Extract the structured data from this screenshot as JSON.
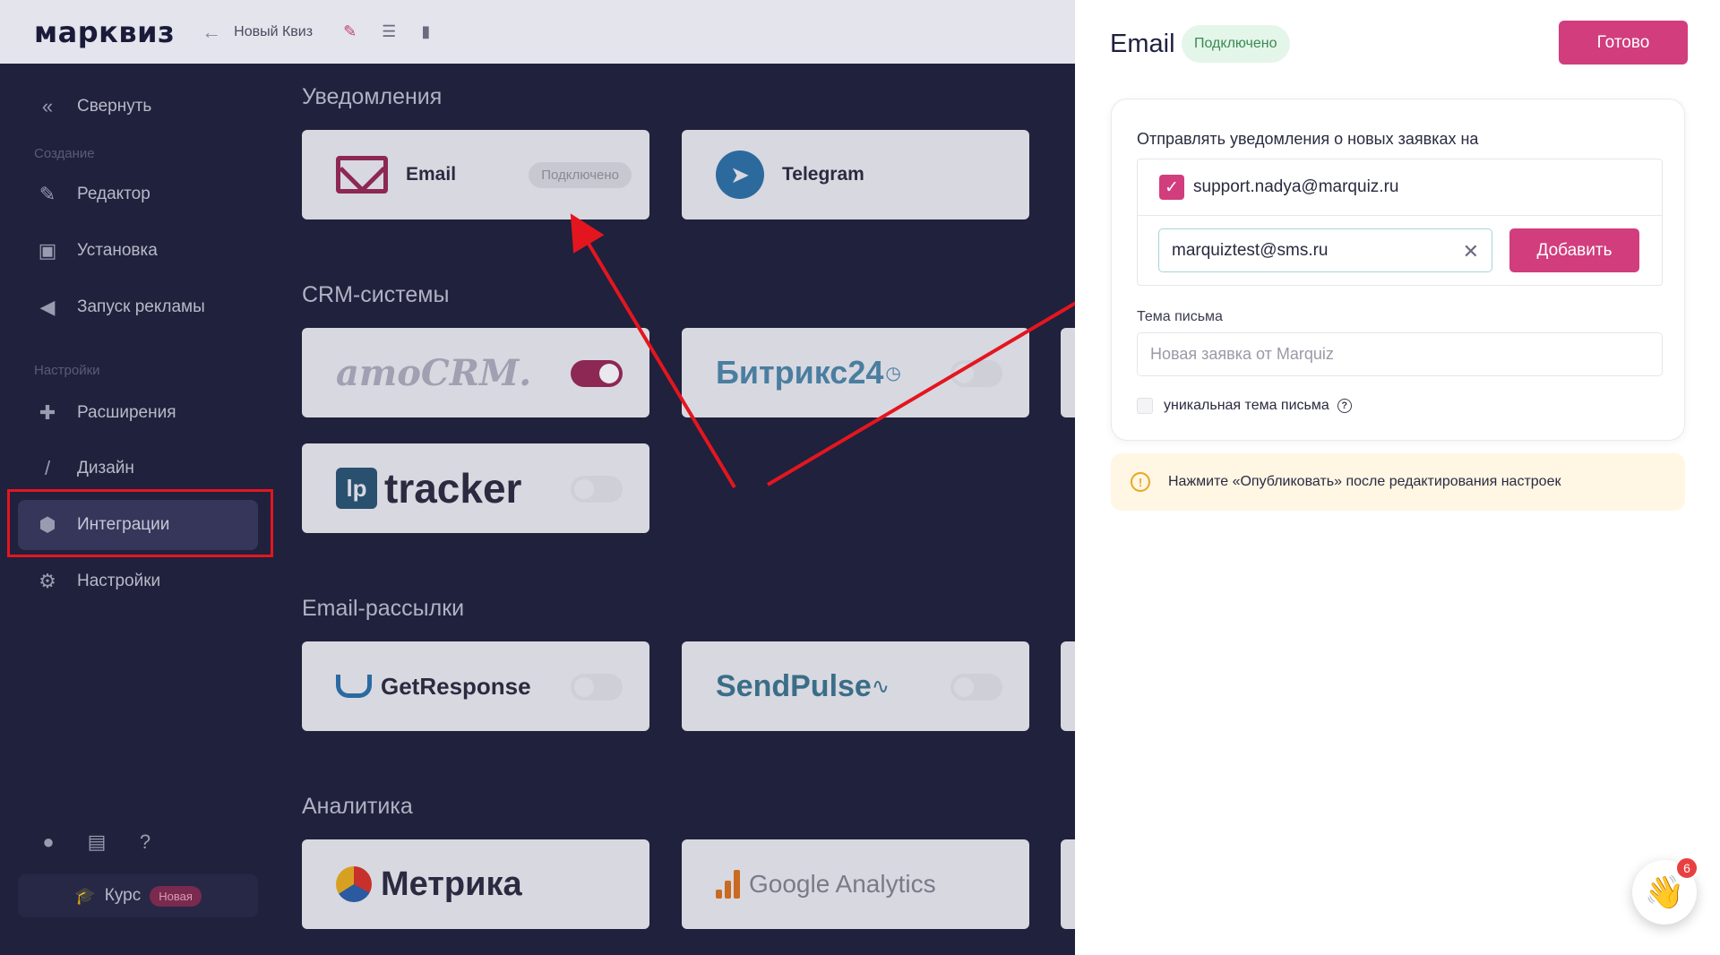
{
  "app": {
    "logo": "марквиз",
    "quiz_title": "Новый Квиз"
  },
  "sidebar": {
    "collapse_label": "Свернуть",
    "section_create": "Создание",
    "section_settings": "Настройки",
    "items": [
      {
        "label": "Редактор",
        "icon": "pencil-icon"
      },
      {
        "label": "Установка",
        "icon": "install-icon"
      },
      {
        "label": "Запуск рекламы",
        "icon": "megaphone-icon"
      },
      {
        "label": "Расширения",
        "icon": "puzzle-icon"
      },
      {
        "label": "Дизайн",
        "icon": "brush-icon"
      },
      {
        "label": "Интеграции",
        "icon": "integrations-icon"
      },
      {
        "label": "Настройки",
        "icon": "gear-icon"
      }
    ],
    "course_label": "Курс",
    "course_badge": "Новая"
  },
  "main": {
    "sections": [
      {
        "title": "Уведомления"
      },
      {
        "title": "CRM-системы"
      },
      {
        "title": "Email-рассылки"
      },
      {
        "title": "Аналитика"
      }
    ],
    "cards": {
      "email": {
        "label": "Email",
        "status": "Подключено"
      },
      "telegram": {
        "label": "Telegram"
      },
      "amocrm": {
        "logo_text": "amoCRM."
      },
      "bitrix": {
        "logo_text": "Битрикс24"
      },
      "tracker": {
        "lp": "lp",
        "logo_text": "tracker"
      },
      "getresponse": {
        "logo_text": "GetResponse"
      },
      "sendpulse": {
        "logo_text": "SendPulse"
      },
      "metrika": {
        "logo_text": "Метрика"
      },
      "ga": {
        "logo_text": "Google Analytics"
      }
    }
  },
  "panel": {
    "title": "Email",
    "status_badge": "Подключено",
    "done_button": "Готово",
    "send_label": "Отправлять уведомления о новых заявках на",
    "emails": [
      {
        "address": "support.nadya@marquiz.ru",
        "checked": true
      }
    ],
    "new_email_value": "marquiztest@sms.ru",
    "add_button": "Добавить",
    "subject_label": "Тема письма",
    "subject_placeholder": "Новая заявка от Marquiz",
    "unique_subject_label": "уникальная тема письма",
    "notice": "Нажмите «Опубликовать» после редактирования настроек"
  },
  "chat": {
    "unread_count": "6"
  },
  "colors": {
    "accent": "#d13d7d",
    "sidebar_bg": "#20213c",
    "annotation_red": "#e3161f"
  }
}
